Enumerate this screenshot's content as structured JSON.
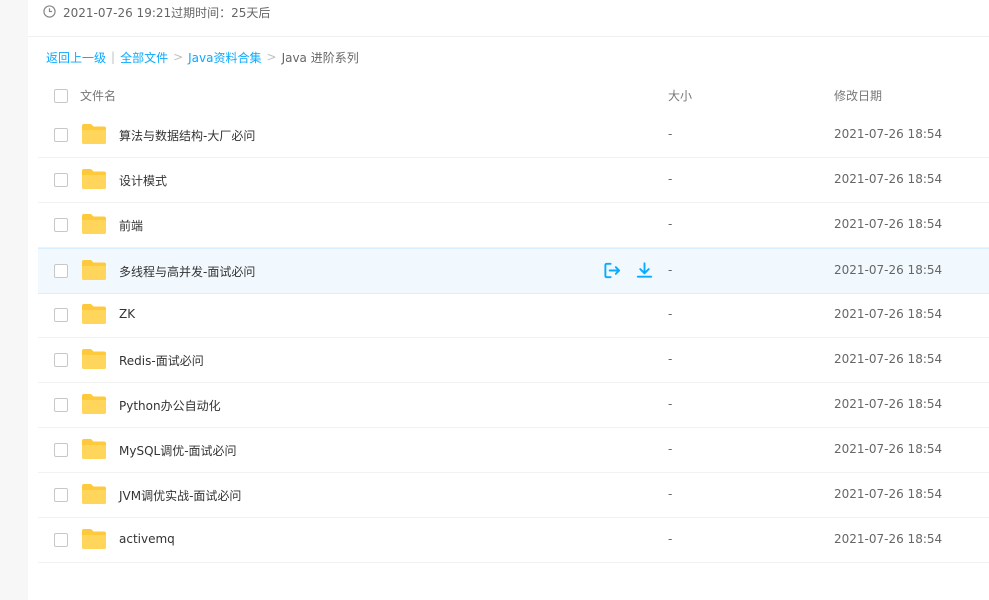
{
  "expire_bar": {
    "text": "2021-07-26 19:21过期时间：25天后",
    "icon": "clock-icon"
  },
  "breadcrumb": {
    "back": "返回上一级",
    "divider": "|",
    "all_files": "全部文件",
    "sep": ">",
    "folder": "Java资料合集",
    "current": "Java 进阶系列"
  },
  "table": {
    "headers": {
      "name": "文件名",
      "size": "大小",
      "date": "修改日期"
    },
    "rows": [
      {
        "name": "算法与数据结构-大厂必问",
        "size": "-",
        "date": "2021-07-26 18:54"
      },
      {
        "name": "设计模式",
        "size": "-",
        "date": "2021-07-26 18:54"
      },
      {
        "name": "前端",
        "size": "-",
        "date": "2021-07-26 18:54"
      },
      {
        "name": "多线程与高并发-面试必问",
        "size": "-",
        "date": "2021-07-26 18:54",
        "hover": true,
        "actions": [
          "save-to-netdisk-icon",
          "download-icon"
        ]
      },
      {
        "name": "ZK",
        "size": "-",
        "date": "2021-07-26 18:54"
      },
      {
        "name": "Redis-面试必问",
        "size": "-",
        "date": "2021-07-26 18:54"
      },
      {
        "name": "Python办公自动化",
        "size": "-",
        "date": "2021-07-26 18:54"
      },
      {
        "name": "MySQL调优-面试必问",
        "size": "-",
        "date": "2021-07-26 18:54"
      },
      {
        "name": "JVM调优实战-面试必问",
        "size": "-",
        "date": "2021-07-26 18:54"
      },
      {
        "name": "activemq",
        "size": "-",
        "date": "2021-07-26 18:54"
      }
    ]
  },
  "colors": {
    "link": "#09aaff",
    "folder": "#ffd04a",
    "hover_row": "#f1f9ff",
    "action_icon": "#09aaff"
  }
}
